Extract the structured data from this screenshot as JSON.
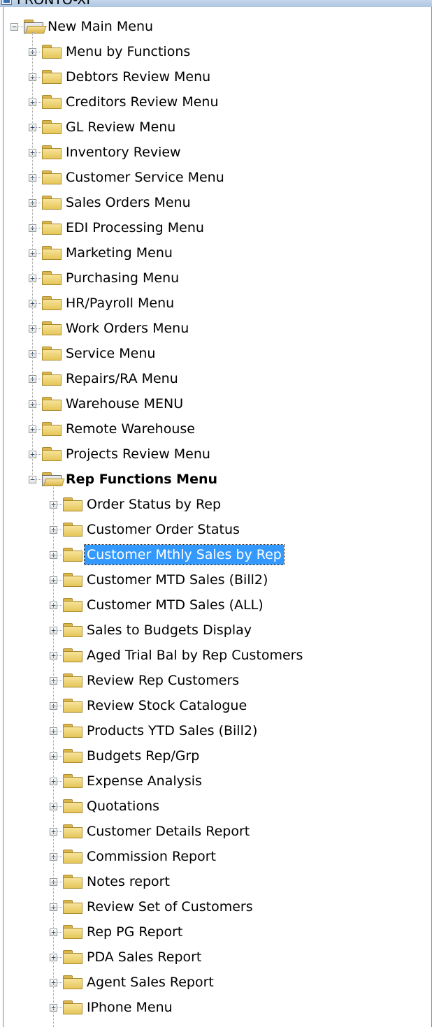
{
  "app": {
    "title": "FRONTO-XI"
  },
  "tree": {
    "root": {
      "label": "New Main Menu",
      "expanded": true
    },
    "level1": [
      {
        "label": "Menu by Functions"
      },
      {
        "label": "Debtors Review Menu"
      },
      {
        "label": "Creditors Review Menu"
      },
      {
        "label": "GL Review Menu"
      },
      {
        "label": "Inventory Review"
      },
      {
        "label": "Customer Service Menu"
      },
      {
        "label": "Sales Orders Menu"
      },
      {
        "label": "EDI Processing Menu"
      },
      {
        "label": "Marketing Menu"
      },
      {
        "label": "Purchasing Menu"
      },
      {
        "label": "HR/Payroll Menu"
      },
      {
        "label": "Work Orders Menu"
      },
      {
        "label": "Service Menu"
      },
      {
        "label": "Repairs/RA Menu"
      },
      {
        "label": "Warehouse MENU"
      },
      {
        "label": "Remote Warehouse"
      },
      {
        "label": "Projects Review Menu"
      },
      {
        "label": "Rep Functions Menu",
        "expanded": true,
        "bold": true
      }
    ],
    "level2": [
      {
        "label": "Order Status by Rep"
      },
      {
        "label": "Customer Order Status"
      },
      {
        "label": "Customer Mthly Sales by Rep",
        "selected": true
      },
      {
        "label": "Customer MTD Sales (Bill2)"
      },
      {
        "label": "Customer MTD Sales (ALL)"
      },
      {
        "label": "Sales to Budgets Display"
      },
      {
        "label": "Aged Trial Bal by Rep Customers"
      },
      {
        "label": "Review Rep Customers"
      },
      {
        "label": "Review Stock Catalogue"
      },
      {
        "label": "Products YTD Sales (Bill2)"
      },
      {
        "label": "Budgets Rep/Grp"
      },
      {
        "label": "Expense Analysis"
      },
      {
        "label": "Quotations"
      },
      {
        "label": "Customer Details Report"
      },
      {
        "label": "Commission Report"
      },
      {
        "label": "Notes report"
      },
      {
        "label": "Review Set of Customers"
      },
      {
        "label": "Rep PG Report"
      },
      {
        "label": "PDA Sales Report"
      },
      {
        "label": "Agent Sales Report"
      },
      {
        "label": "IPhone Menu"
      }
    ]
  },
  "colors": {
    "selection": "#3399ff",
    "folder": "#e6c65a",
    "tree_lines": "#a0a0a0"
  }
}
